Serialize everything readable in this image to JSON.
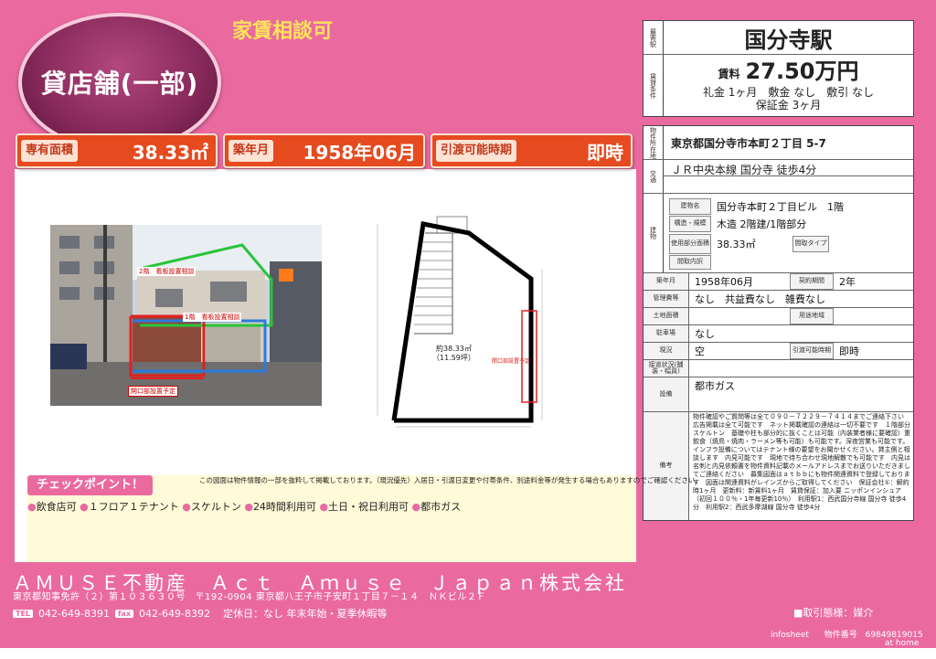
{
  "header": {
    "property_type": "貸店舗(一部)",
    "consultation_note": "家賃相談可",
    "badges": [
      {
        "label": "専有面積",
        "value": "38.33㎡"
      },
      {
        "label": "築年月",
        "value": "1958年06月"
      },
      {
        "label": "引渡可能時期",
        "value": "即時"
      }
    ]
  },
  "summary": {
    "station_label": "最寄駅",
    "station": "国分寺駅",
    "terms_label": "賃貸条件",
    "rent_label": "賃料",
    "rent": "27.50万円",
    "conditions_line1": "礼金 1ヶ月　敷金 なし　敷引 なし",
    "conditions_line2": "保証金 3ヶ月"
  },
  "details": {
    "address_label": "物件所在地",
    "address": "東京都国分寺市本町２丁目 5-7",
    "transport_label": "交通",
    "transport": "ＪＲ中央本線 国分寺 徒歩4分",
    "building_label": "建物",
    "building_name_label": "建物名",
    "building_name": "国分寺本町２丁目ビル　1階",
    "structure_label": "構造・規模",
    "structure": "木造 2階建/1階部分",
    "usable_area_label": "使用部分面積",
    "usable_area": "38.33㎡",
    "layout_type_label": "間取タイプ",
    "layout_label": "間取内訳",
    "built_label": "築年月",
    "built": "1958年06月",
    "contract_label": "契約期間",
    "contract": "2年",
    "management_label": "管理費等",
    "management": "なし　共益費なし　雑費なし",
    "land_area_label": "土地面積",
    "zoning_label": "用途地域",
    "parking_label": "駐車場",
    "parking": "なし",
    "status_label": "現況",
    "status": "空",
    "handover_label": "引渡可能時期",
    "handover": "即時",
    "road_label": "接道状況(舗装・幅員)",
    "facilities_label": "設備",
    "facilities": "都市ガス",
    "remarks_label": "備考",
    "remarks": "物件確認やご質問等は全て０９０－７２２９－７４１４までご連絡下さい　広告掲載は全て可能です　ネット掲載確認の連絡は一切不要です　１階部分スケルトン　基礎や柱も部分的に抜くことは可能（内装業者様に要確認）重飲食（焼鳥・焼肉・ラーメン等も可能）も可能です。深夜営業も可能です。インフラ設備についてはテナント様の要望をお聞かせください。貸主側と相談します　内見可能です　現地で待ち合わせ現地解散でも可能です　内見は名刺と内見依頼書を物件資料記載のメールアドレスまでお送りいただきましてご連絡ください　募集図面はａｔｂｂにも物件関連資料で登録しております　図面は関連資料がレインズからご取得してください　保証会社①：解約時1ヶ月　更新料：新賃料1ヶ月　賃貸保証：加入要 ニッポンインシュア（初回１００％・1年毎更新10％）　利用駅1：西武国分寺線 国分寺 徒歩4分　利用駅2：西武多摩湖線 国分寺 徒歩4分"
  },
  "photo": {
    "label_2f": "2階　看板設置相談",
    "label_1f": "1階　看板設置相談",
    "label_opening": "開口部設置予定"
  },
  "floorplan": {
    "area_line1": "約38.33㎡",
    "area_line2": "（11.59坪）",
    "opening_note": "開口部設置予定"
  },
  "disclaimer": "この図面は物件情報の一部を抜粋して掲載しております。（現況優先）入居日・引渡日変更や付帯条件、別途料金等が発生する場合もありますのでご確認ください。",
  "checkpoints": {
    "title": "チェックポイント！",
    "items": [
      "飲食店可",
      "１フロア１テナント",
      "スケルトン",
      "24時間利用可",
      "土日・祝日利用可",
      "都市ガス"
    ]
  },
  "footer": {
    "company": "ＡＭＵＳＥ不動産　Ａｃｔ　Ａｍｕｓｅ　Ｊａｐａｎ株式会社",
    "license": "東京都知事免許（２）第１０３６３０号　〒192-0904 東京都八王子市子安町１丁目７－１４　ＮＫビル２Ｆ",
    "tel_tag": "TEL",
    "tel": "042-649-8391",
    "fax_tag": "fax",
    "fax": "042-649-8392",
    "holidays": "定休日：なし 年末年始・夏季休暇等",
    "transaction": "■取引態様：媒介",
    "infosheet": "infosheet",
    "property_no_label": "物件番号",
    "property_no": "69849819015",
    "brand": "at home"
  }
}
